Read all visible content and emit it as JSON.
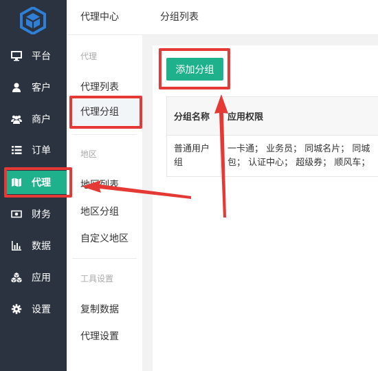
{
  "brand": {
    "logo_icon": "cube-hexagon-logo"
  },
  "nav": {
    "items": [
      {
        "label": "平台",
        "icon": "monitor-icon"
      },
      {
        "label": "客户",
        "icon": "user-icon"
      },
      {
        "label": "商户",
        "icon": "users-icon"
      },
      {
        "label": "订单",
        "icon": "list-icon"
      },
      {
        "label": "代理",
        "icon": "map-icon",
        "active": true
      },
      {
        "label": "财务",
        "icon": "money-icon"
      },
      {
        "label": "数据",
        "icon": "bar-chart-icon"
      },
      {
        "label": "应用",
        "icon": "cubes-icon"
      },
      {
        "label": "设置",
        "icon": "gear-icon"
      }
    ]
  },
  "sub": {
    "title": "代理中心",
    "group_agent": "代理",
    "agent_list": "代理列表",
    "agent_group": "代理分组",
    "group_region": "地区",
    "region_list": "地区列表",
    "region_group": "地区分组",
    "custom_region": "自定义地区",
    "group_tools": "工具设置",
    "copy_data": "复制数据",
    "agent_settings": "代理设置"
  },
  "main": {
    "title": "分组列表",
    "add_button": "添加分组",
    "columns": [
      "分组名称",
      "应用权限"
    ],
    "rows": [
      {
        "name": "普通用户组",
        "permissions_line1": "一卡通；  业务员；  同城名片；  同城",
        "permissions_line2": "包；  认证中心；  超级券；  顺风车；"
      }
    ]
  },
  "colors": {
    "accent": "#1fb18c",
    "sidebar": "#2b3340",
    "annotation": "#e53935"
  }
}
